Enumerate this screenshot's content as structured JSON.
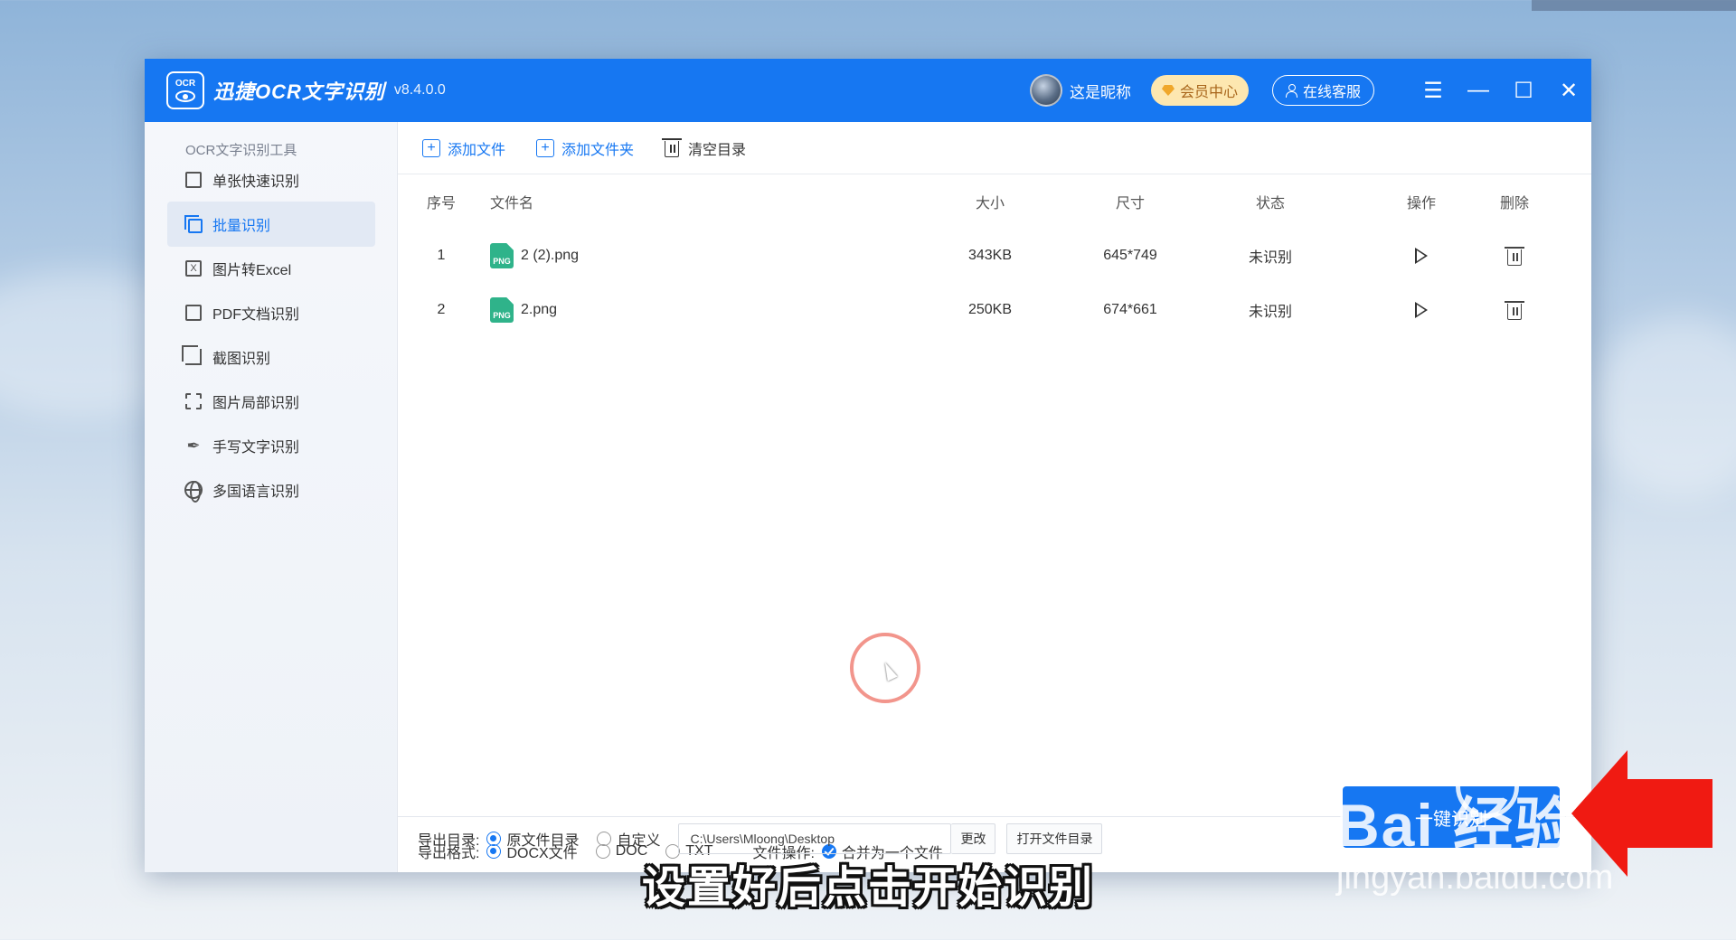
{
  "app": {
    "logo_text": "OCR",
    "title": "迅捷OCR文字识别",
    "version": "v8.4.0.0",
    "user_name": "这是昵称",
    "vip_label": "会员中心",
    "service_label": "在线客服",
    "accent_color": "#1677f2"
  },
  "window_controls": {
    "menu": "☰",
    "minimize": "—",
    "maximize": "☐",
    "close": "✕"
  },
  "sidebar": {
    "heading": "OCR文字识别工具",
    "items": [
      {
        "label": "单张快速识别",
        "icon": "edit-icon",
        "active": false
      },
      {
        "label": "批量识别",
        "icon": "stack-icon",
        "active": true
      },
      {
        "label": "图片转Excel",
        "icon": "excel-icon",
        "active": false
      },
      {
        "label": "PDF文档识别",
        "icon": "pdf-icon",
        "active": false
      },
      {
        "label": "截图识别",
        "icon": "crop-icon",
        "active": false
      },
      {
        "label": "图片局部识别",
        "icon": "region-icon",
        "active": false
      },
      {
        "label": "手写文字识别",
        "icon": "pen-icon",
        "active": false
      },
      {
        "label": "多国语言识别",
        "icon": "globe-icon",
        "active": false
      }
    ]
  },
  "toolbar": {
    "add_file": "添加文件",
    "add_folder": "添加文件夹",
    "clear_list": "清空目录"
  },
  "table": {
    "columns": [
      "序号",
      "文件名",
      "大小",
      "尺寸",
      "状态",
      "操作",
      "删除"
    ],
    "rows": [
      {
        "index": "1",
        "name": "2 (2).png",
        "size": "343KB",
        "dimensions": "645*749",
        "status": "未识别"
      },
      {
        "index": "2",
        "name": "2.png",
        "size": "250KB",
        "dimensions": "674*661",
        "status": "未识别"
      }
    ],
    "file_type_badge": "PNG"
  },
  "export": {
    "format_label": "导出格式:",
    "formats": [
      "DOCX文件",
      "DOC",
      "TXT"
    ],
    "selected_format": "DOCX文件",
    "file_op_label": "文件操作:",
    "merge_label": "合并为一个文件",
    "dir_label": "导出目录:",
    "dir_options": [
      "原文件目录",
      "自定义"
    ],
    "selected_dir": "原文件目录",
    "path_value": "C:\\Users\\Mloong\\Desktop",
    "change_button": "更改",
    "open_dir_button": "打开文件目录",
    "start_button": "一键识别"
  },
  "overlay": {
    "subtitle": "设置好后点击开始识别",
    "watermark_brand": "Bai 经验",
    "watermark_url": "jingyan.baidu.com"
  }
}
